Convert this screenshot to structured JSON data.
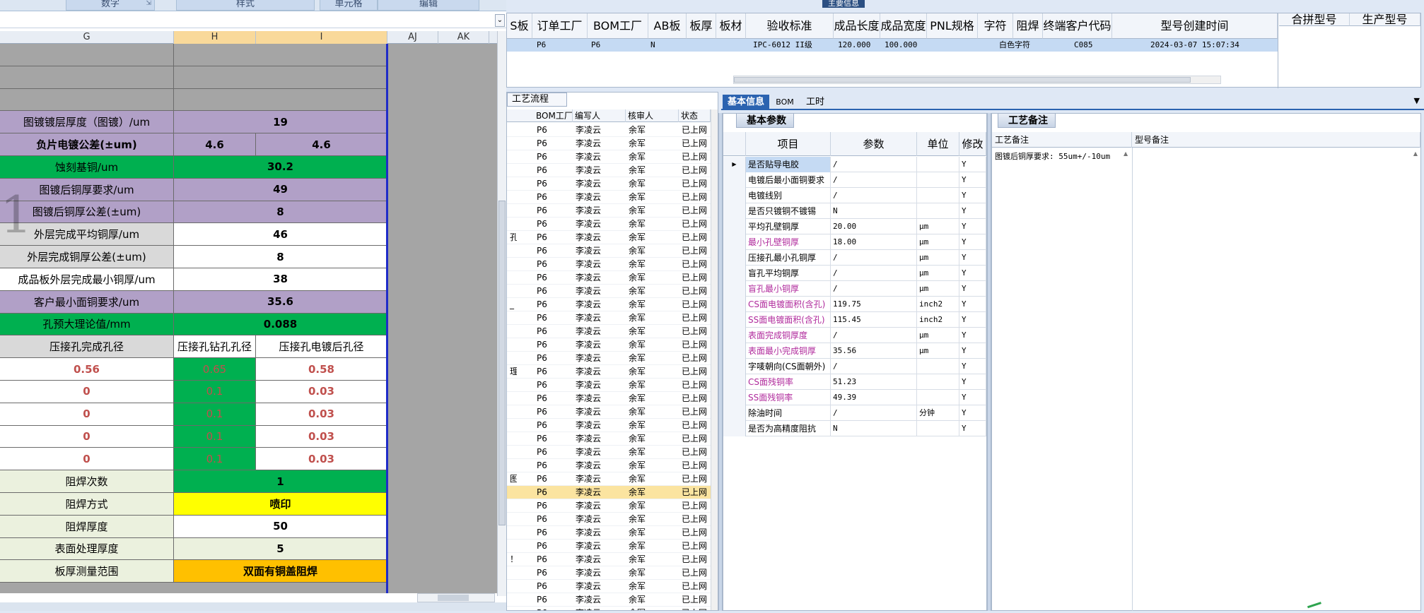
{
  "excel": {
    "ribbon_groups": [
      "数字",
      "样式",
      "单元格",
      "编辑"
    ],
    "columns": [
      "G",
      "H",
      "I",
      "AJ",
      "AK"
    ],
    "rows": [
      {
        "label": "",
        "h": "",
        "i": "",
        "style": "gray"
      },
      {
        "label": "",
        "h": "",
        "i": "",
        "style": "gray"
      },
      {
        "label": "",
        "h": "",
        "i": "",
        "style": "gray"
      },
      {
        "label": "图镀镀层厚度（图镀）/um",
        "h": "19",
        "i": "",
        "style": "purple",
        "merged": true
      },
      {
        "label": "负片电镀公差(±um)",
        "h": "4.6",
        "i": "4.6",
        "style": "purple",
        "boldlabel": true
      },
      {
        "label": "蚀刻基铜/um",
        "h": "30.2",
        "i": "",
        "style": "green",
        "merged": true
      },
      {
        "label": "图镀后铜厚要求/um",
        "h": "49",
        "i": "",
        "style": "purple",
        "merged": true
      },
      {
        "label": "图镀后铜厚公差(±um)",
        "h": "8",
        "i": "",
        "style": "purple",
        "merged": true
      },
      {
        "label": "外层完成平均铜厚/um",
        "h": "46",
        "i": "",
        "style": "lgray-white",
        "merged": true
      },
      {
        "label": "外层完成铜厚公差(±um)",
        "h": "8",
        "i": "",
        "style": "lgray-white",
        "merged": true
      },
      {
        "label": "成品板外层完成最小铜厚/um",
        "h": "38",
        "i": "",
        "style": "white",
        "merged": true
      },
      {
        "label": "客户最小面铜要求/um",
        "h": "35.6",
        "i": "",
        "style": "purple",
        "merged": true
      },
      {
        "label": "孔预大理论值/mm",
        "h": "0.088",
        "i": "",
        "style": "green",
        "merged": true
      },
      {
        "label": "压接孔完成孔径",
        "h": "压接孔钻孔孔径",
        "i": "压接孔电镀后孔径",
        "style": "header3"
      },
      {
        "label": "0.56",
        "h": "0.65",
        "i": "0.58",
        "style": "hole"
      },
      {
        "label": "0",
        "h": "0.1",
        "i": "0.03",
        "style": "hole"
      },
      {
        "label": "0",
        "h": "0.1",
        "i": "0.03",
        "style": "hole"
      },
      {
        "label": "0",
        "h": "0.1",
        "i": "0.03",
        "style": "hole"
      },
      {
        "label": "0",
        "h": "0.1",
        "i": "0.03",
        "style": "hole"
      },
      {
        "label": "阻焊次数",
        "h": "1",
        "i": "",
        "style": "beige-green",
        "merged": true
      },
      {
        "label": "阻焊方式",
        "h": "喷印",
        "i": "",
        "style": "beige-yellow",
        "merged": true
      },
      {
        "label": "阻焊厚度",
        "h": "50",
        "i": "",
        "style": "beige-white",
        "merged": true
      },
      {
        "label": "表面处理厚度",
        "h": "5",
        "i": "",
        "style": "beige-beige",
        "merged": true
      },
      {
        "label": "板厚测量范围",
        "h": "双面有铜盖阻焊",
        "i": "",
        "style": "beige-orange",
        "merged": true
      }
    ],
    "watermark": "1"
  },
  "top": {
    "tab_label": "主要信息",
    "headers": [
      "S板",
      "订单工厂",
      "BOM工厂",
      "AB板",
      "板厚",
      "板材",
      "验收标准",
      "成品长度",
      "成品宽度",
      "PNL规格",
      "字符",
      "阻焊",
      "终端客户代码",
      "型号创建时间",
      "合拼型号",
      "生产型号"
    ],
    "row": {
      "order_factory": "P6",
      "bom_factory": "P6",
      "ab": "N",
      "standard": "IPC-6012 II级",
      "length": "120.000",
      "width": "100.000",
      "char": "白色字符",
      "customer": "C085",
      "created": "2024-03-07 15:07:34"
    }
  },
  "middle": {
    "tab": "工艺流程",
    "headers": [
      "BOM工厂",
      "编写人",
      "核审人",
      "状态"
    ],
    "row_template": {
      "factory": "P6",
      "writer": "李凌云",
      "reviewer": "余军",
      "status": "已上网"
    },
    "row_count": 37,
    "selected_row": 27,
    "edge_labels": {
      "8": "孔",
      "13": "_",
      "18": "理",
      "26": "图",
      "32": "！"
    }
  },
  "detail": {
    "tabs": [
      "基本信息",
      "BOM",
      "工时"
    ],
    "basic_group": "基本参数",
    "note_group": "工艺备注",
    "param_headers": [
      "项目",
      "参数",
      "单位",
      "修改"
    ],
    "params": [
      {
        "name": "是否贴导电胶",
        "value": "/",
        "unit": "",
        "flag": "Y",
        "hl": false
      },
      {
        "name": "电镀后最小面铜要求",
        "value": "/",
        "unit": "",
        "flag": "Y",
        "hl": false
      },
      {
        "name": "电镀线别",
        "value": "/",
        "unit": "",
        "flag": "Y",
        "hl": false
      },
      {
        "name": "是否只镀铜不镀锡",
        "value": "N",
        "unit": "",
        "flag": "Y",
        "hl": false
      },
      {
        "name": "平均孔壁铜厚",
        "value": "20.00",
        "unit": "μm",
        "flag": "Y",
        "hl": false
      },
      {
        "name": "最小孔壁铜厚",
        "value": "18.00",
        "unit": "μm",
        "flag": "Y",
        "hl": true
      },
      {
        "name": "压接孔最小孔铜厚",
        "value": "/",
        "unit": "μm",
        "flag": "Y",
        "hl": false
      },
      {
        "name": "盲孔平均铜厚",
        "value": "/",
        "unit": "μm",
        "flag": "Y",
        "hl": false
      },
      {
        "name": "盲孔最小铜厚",
        "value": "/",
        "unit": "μm",
        "flag": "Y",
        "hl": true
      },
      {
        "name": "CS面电镀面积(含孔)",
        "value": "119.75",
        "unit": "inch2",
        "flag": "Y",
        "hl": true
      },
      {
        "name": "SS面电镀面积(含孔)",
        "value": "115.45",
        "unit": "inch2",
        "flag": "Y",
        "hl": true
      },
      {
        "name": "表面完成铜厚度",
        "value": "/",
        "unit": "μm",
        "flag": "Y",
        "hl": true
      },
      {
        "name": "表面最小完成铜厚",
        "value": "35.56",
        "unit": "μm",
        "flag": "Y",
        "hl": true
      },
      {
        "name": "字唛朝向(CS面朝外)",
        "value": "/",
        "unit": "",
        "flag": "Y",
        "hl": false
      },
      {
        "name": "CS面残铜率",
        "value": "51.23",
        "unit": "",
        "flag": "Y",
        "hl": true
      },
      {
        "name": "SS面残铜率",
        "value": "49.39",
        "unit": "",
        "flag": "Y",
        "hl": true
      },
      {
        "name": "除油时间",
        "value": "/",
        "unit": "分钟",
        "flag": "Y",
        "hl": false
      },
      {
        "name": "是否为高精度阻抗",
        "value": "N",
        "unit": "",
        "flag": "Y",
        "hl": false
      }
    ],
    "note_headers": [
      "工艺备注",
      "型号备注"
    ],
    "note_text": "图镀后铜厚要求: 55um+/-10um"
  },
  "colors": {
    "accent": "#2b63b0",
    "purple": "#b1a0c7",
    "green": "#00b050",
    "yellow": "#ffff00",
    "orange": "#ffc000",
    "highlight_text": "#b02a9c"
  }
}
